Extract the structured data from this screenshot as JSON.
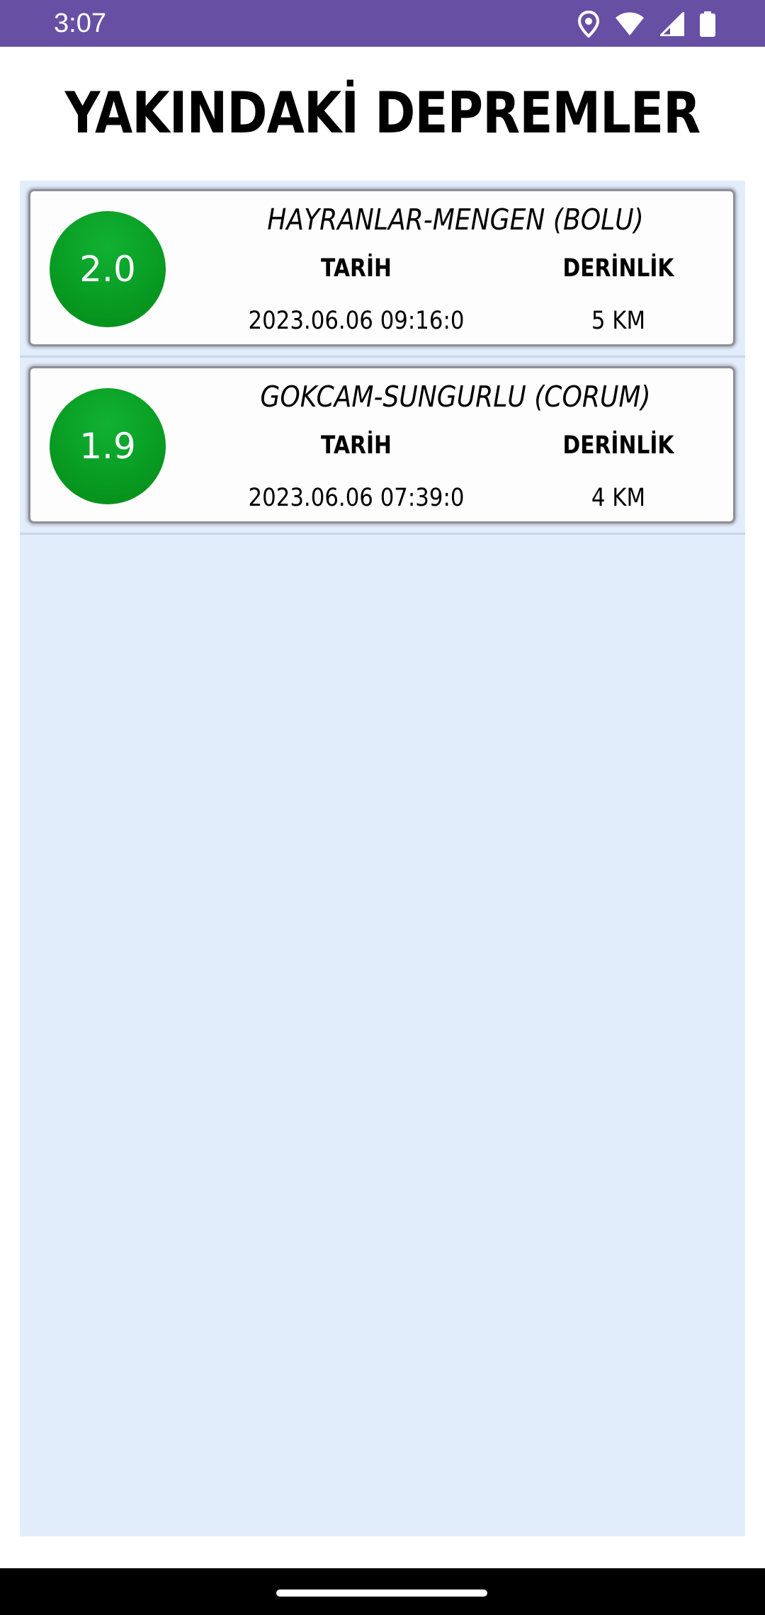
{
  "status_bar": {
    "time": "3:07",
    "icons": [
      "location-icon",
      "wifi-icon",
      "signal-icon",
      "battery-icon"
    ],
    "background": "#6750a4"
  },
  "page": {
    "title": "YAKINDAKİ DEPREMLER"
  },
  "colors": {
    "magnitude_badge": "#089a22",
    "list_background": "#e2edfc",
    "card_background": "#fdfdfd"
  },
  "earthquakes": [
    {
      "magnitude": "2.0",
      "location": "HAYRANLAR-MENGEN (BOLU)",
      "date_label": "TARİH",
      "date_value": "2023.06.06 09:16:0",
      "depth_label": "DERİNLİK",
      "depth_value": "5 KM"
    },
    {
      "magnitude": "1.9",
      "location": "GOKCAM-SUNGURLU (CORUM)",
      "date_label": "TARİH",
      "date_value": "2023.06.06 07:39:0",
      "depth_label": "DERİNLİK",
      "depth_value": "4 KM"
    }
  ],
  "nav_bar": {
    "gesture": "home-gesture-handle"
  }
}
